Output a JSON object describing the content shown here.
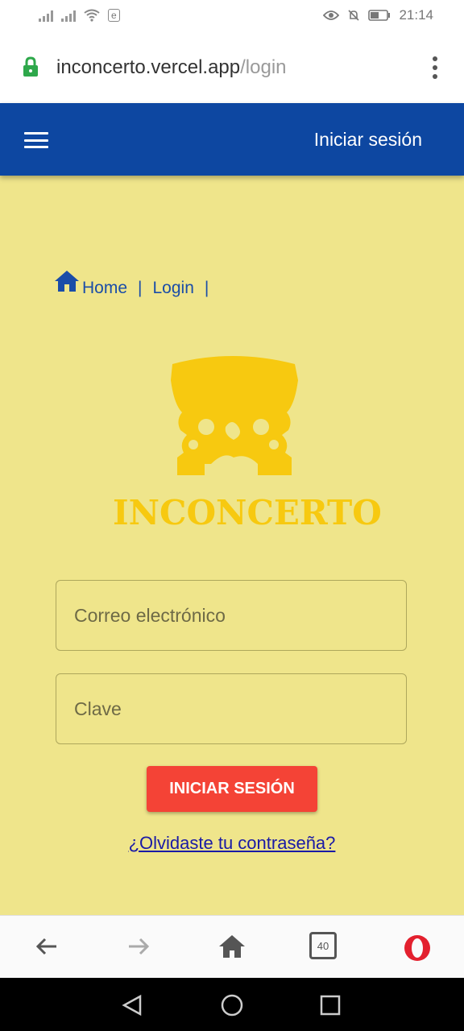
{
  "statusbar": {
    "carrier_icon": "e",
    "time": "21:14"
  },
  "browser": {
    "url_host": "inconcerto.vercel.app",
    "url_path": "/login"
  },
  "appbar": {
    "title": "Iniciar sesión"
  },
  "breadcrumb": {
    "home": "Home",
    "login": "Login",
    "sep": "|"
  },
  "logo": {
    "text": "INCONCERTO"
  },
  "form": {
    "email_placeholder": "Correo electrónico",
    "password_placeholder": "Clave",
    "submit_label": "INICIAR SESIÓN",
    "forgot_label": "¿Olvidaste tu contraseña?"
  },
  "browser_nav": {
    "tab_count": "40"
  },
  "colors": {
    "appbar": "#0d47a1",
    "page_bg": "#efe58b",
    "brand_yellow": "#f7c910",
    "button": "#f44336"
  }
}
